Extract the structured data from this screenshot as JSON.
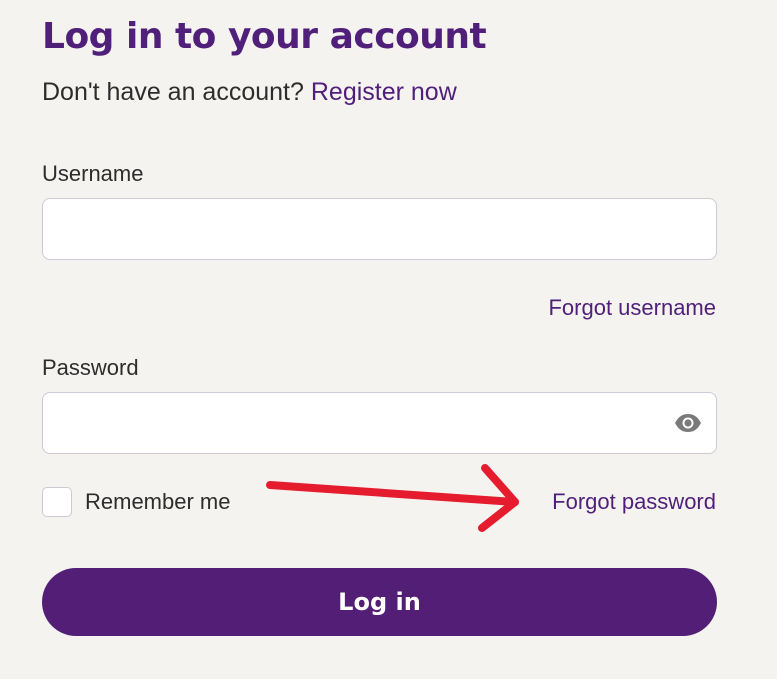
{
  "page": {
    "title": "Log in to your account"
  },
  "register": {
    "prompt": "Don't have an account?",
    "link_label": "Register now"
  },
  "username": {
    "label": "Username",
    "value": "",
    "forgot_label": "Forgot username"
  },
  "password": {
    "label": "Password",
    "value": "",
    "toggle_icon": "eye-icon",
    "forgot_label": "Forgot password"
  },
  "remember": {
    "label": "Remember me",
    "checked": false
  },
  "login_button": {
    "label": "Log in"
  },
  "annotation": {
    "arrow_color": "#e51c2e"
  },
  "colors": {
    "brand": "#521e76",
    "link": "#4f1f7a",
    "background": "#f5f3f0"
  }
}
